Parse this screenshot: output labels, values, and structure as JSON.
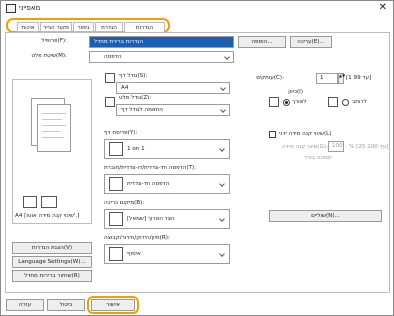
{
  "window": {
    "title": "מאפייני",
    "close_label": "✕"
  },
  "tabs": [
    "הגדרות בסיסיות",
    "הגדרת דף",
    "גימור",
    "מקור הנייר",
    "איכות"
  ],
  "profile": {
    "label": "פרופיל(F):",
    "value": "הגדרות ברירת מחדל",
    "add_button": "הוספה...",
    "edit_button": "עריכה(E)..."
  },
  "output_method": {
    "label": "שיטת פלט(M):",
    "value": "הדפסה"
  },
  "page_size": {
    "label": "גודל דף(S):",
    "value": "A4"
  },
  "output_size": {
    "label": "גודל פלט(Z):",
    "value": "התאמה לגודל דף"
  },
  "copies": {
    "label": "עותקים(C):",
    "value": "1",
    "range": "[1 עד 99]"
  },
  "orientation": {
    "label": "כיוון(I)",
    "portrait": "לאורך",
    "landscape": "לרוחב",
    "selected": "portrait"
  },
  "page_layout": {
    "label": "פריסת דף(Y):",
    "value": "1 on 1"
  },
  "manual_scaling": {
    "label": "שינוי קנה מידה ידני(L)",
    "checked": false,
    "scale_label": "שינוי קנה מידה(G):",
    "scale_value": "100",
    "scale_unit": "% [25 עד 200]"
  },
  "watermark": {
    "label": "תמונה בורד"
  },
  "duplex": {
    "label": "הדפסה חד-צדדית/דו-צדדית/חוברת(T):",
    "value": "הדפסה חד-צדדית"
  },
  "binding": {
    "label": "מיקום כריכה(B):",
    "value": "הצד הארוך [שמאל]"
  },
  "binding_margin_button": "שוליים(N)...",
  "collate": {
    "label": "מיון/הידוק/חירור/קבוצה(R):",
    "value": "איסוף"
  },
  "preview_caption": "A4 [שינוי קנה מידה אוטו'.]",
  "left_buttons": [
    "הצגת הגדרות(V)",
    "Language Settings(W)...",
    "שחזור ברירות מחדל(R)"
  ],
  "footer": {
    "ok": "אישור",
    "cancel": "ביטול",
    "help": "עזרה"
  },
  "highlight_color": "#f0a000"
}
